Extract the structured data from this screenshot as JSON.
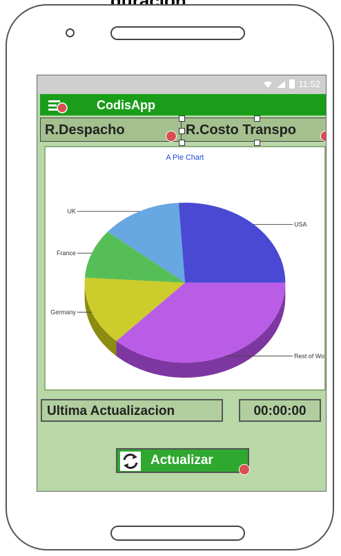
{
  "caption": "guración",
  "status": {
    "time": "11:52"
  },
  "appbar": {
    "title": "CodisApp"
  },
  "tabs": [
    {
      "label": "R.Despacho"
    },
    {
      "label": "R.Costo Transpo"
    }
  ],
  "chart_data": {
    "type": "pie",
    "title": "A Pie Chart",
    "labels": [
      "Rest of World",
      "Germany",
      "France",
      "UK",
      "USA"
    ],
    "values": [
      37,
      14,
      10,
      13,
      26
    ],
    "colors": [
      "#b44fe4",
      "#c8c81a",
      "#48b848",
      "#5aa0e0",
      "#3a3ad0"
    ]
  },
  "footer": {
    "last_update_label": "Ultima Actualizacion",
    "last_update_time": "00:00:00"
  },
  "button": {
    "label": "Actualizar"
  }
}
